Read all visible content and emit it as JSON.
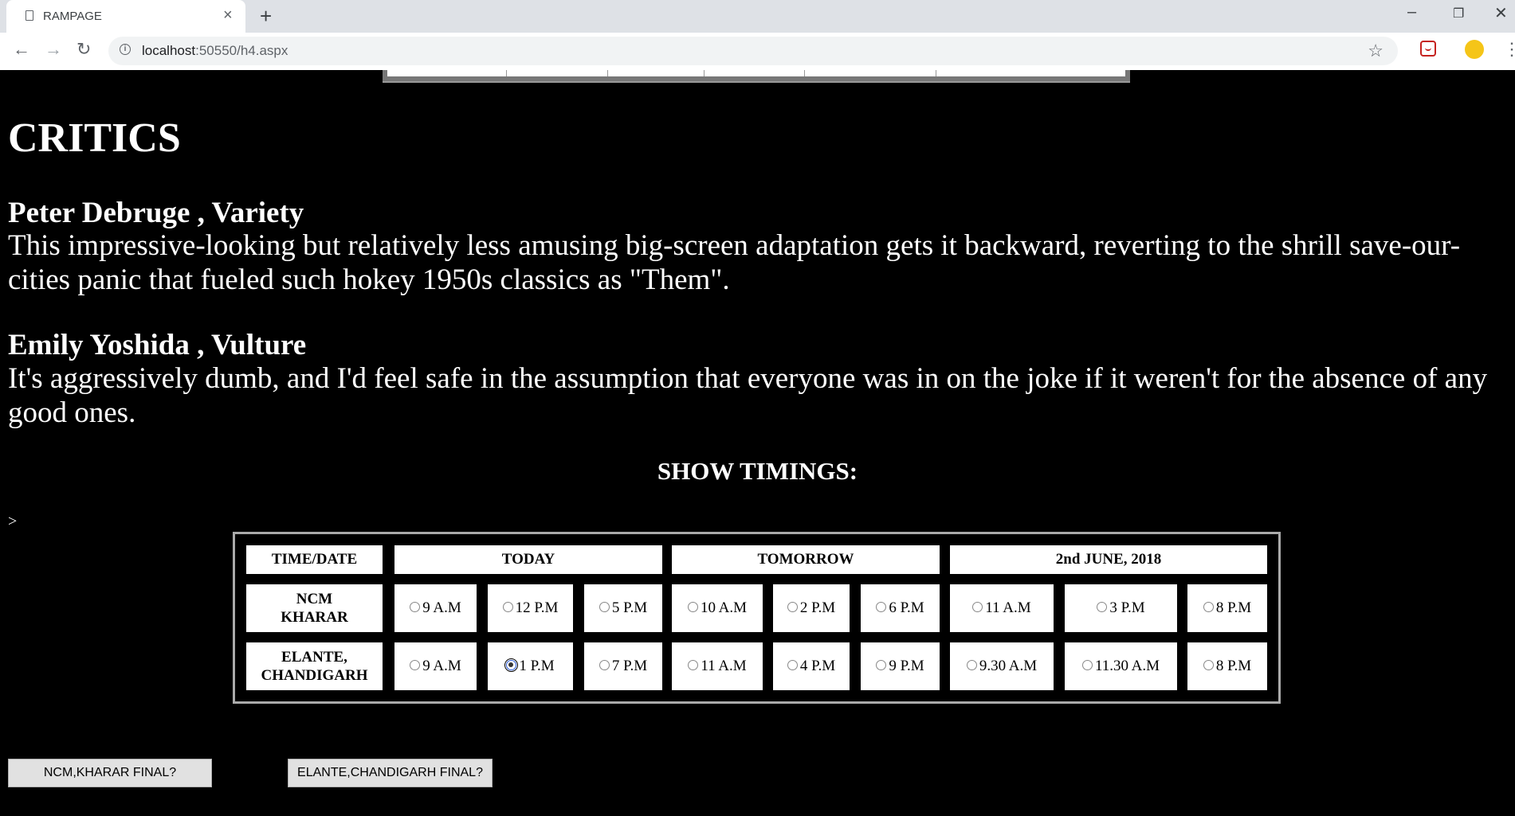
{
  "browser": {
    "tab_title": "RAMPAGE",
    "url_host": "localhost",
    "url_path": ":50550/h4.aspx"
  },
  "page": {
    "section_title": "CRITICS",
    "critics": [
      {
        "name": "Peter Debruge , Variety",
        "quote": "This impressive-looking but relatively less amusing big-screen adaptation gets it backward, reverting to the shrill save-our-cities panic that fueled such hokey 1950s classics as \"Them\"."
      },
      {
        "name": "Emily Yoshida , Vulture",
        "quote": "It's aggressively dumb, and I'd feel safe in the assumption that everyone was in on the joke if it weren't for the absence of any good ones."
      }
    ],
    "show_timings_title": "SHOW TIMINGS:",
    "stray_text": ">",
    "timings": {
      "headers": [
        "TIME/DATE",
        "TODAY",
        "TOMORROW",
        "2nd JUNE, 2018"
      ],
      "venues": [
        {
          "name": "NCM KHARAR",
          "times": [
            "9 A.M",
            "12 P.M",
            "5 P.M",
            "10 A.M",
            "2 P.M",
            "6 P.M",
            "11 A.M",
            "3 P.M",
            "8 P.M"
          ],
          "selected": -1
        },
        {
          "name": "ELANTE, CHANDIGARH",
          "times": [
            "9 A.M",
            "1 P.M",
            "7 P.M",
            "11 A.M",
            "4 P.M",
            "9 P.M",
            "9.30 A.M",
            "11.30 A.M",
            "8 P.M"
          ],
          "selected": 1
        }
      ]
    },
    "buttons": {
      "ncm_final": "NCM,KHARAR FINAL?",
      "elante_final": "ELANTE,CHANDIGARH FINAL?"
    }
  }
}
